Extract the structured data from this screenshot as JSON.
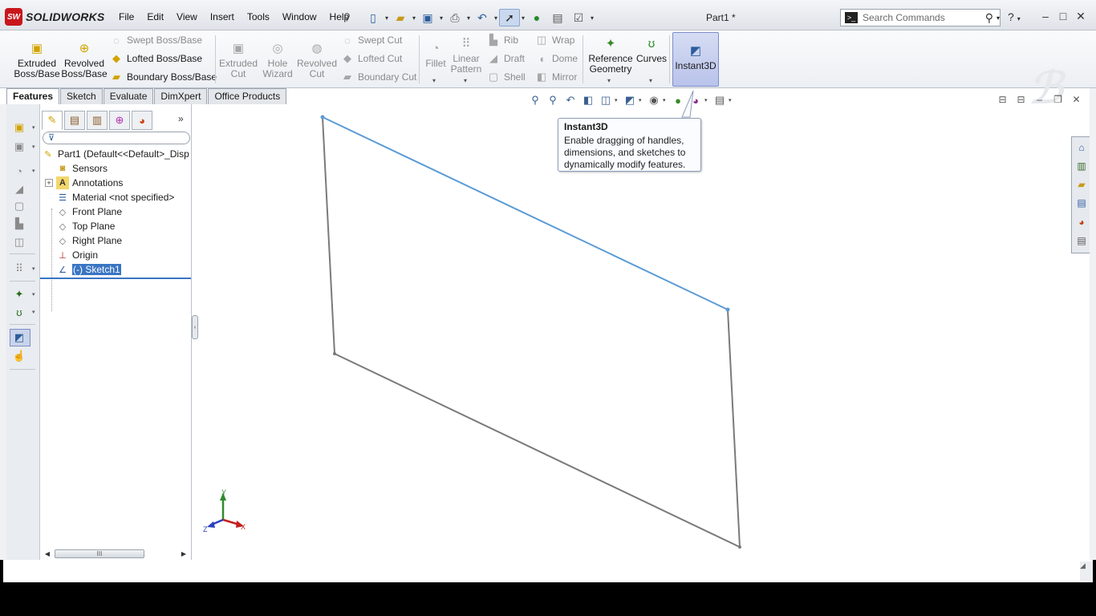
{
  "app": {
    "logo_prefix": "SW",
    "logo_name": "SOLIDWORKS",
    "document_title": "Part1 *"
  },
  "menu": [
    "File",
    "Edit",
    "View",
    "Insert",
    "Tools",
    "Window",
    "Help"
  ],
  "search": {
    "placeholder": "Search Commands"
  },
  "ribbon": {
    "extruded_boss": "Extruded\nBoss/Base",
    "revolved_boss": "Revolved\nBoss/Base",
    "swept_boss": "Swept Boss/Base",
    "lofted_boss": "Lofted Boss/Base",
    "boundary_boss": "Boundary Boss/Base",
    "extruded_cut": "Extruded\nCut",
    "hole_wizard": "Hole\nWizard",
    "revolved_cut": "Revolved\nCut",
    "swept_cut": "Swept Cut",
    "lofted_cut": "Lofted Cut",
    "boundary_cut": "Boundary Cut",
    "fillet": "Fillet",
    "linear_pattern": "Linear\nPattern",
    "rib": "Rib",
    "draft": "Draft",
    "shell": "Shell",
    "wrap": "Wrap",
    "dome": "Dome",
    "mirror": "Mirror",
    "reference_geometry": "Reference\nGeometry",
    "curves": "Curves",
    "instant3d": "Instant3D"
  },
  "tabs": [
    "Features",
    "Sketch",
    "Evaluate",
    "DimXpert",
    "Office Products"
  ],
  "tree": {
    "root": "Part1  (Default<<Default>_Disp",
    "items": [
      {
        "label": "Sensors"
      },
      {
        "label": "Annotations"
      },
      {
        "label": "Material <not specified>"
      },
      {
        "label": "Front Plane"
      },
      {
        "label": "Top Plane"
      },
      {
        "label": "Right Plane"
      },
      {
        "label": "Origin"
      },
      {
        "label": "(-) Sketch1"
      }
    ],
    "expand_marker": "+",
    "scroll_grip": "III"
  },
  "tooltip": {
    "title": "Instant3D",
    "description": "Enable dragging of handles, dimensions, and sketches to dynamically modify features."
  },
  "triad": {
    "x": "X",
    "y": "Y",
    "z": "Z"
  },
  "sketch": {
    "shape": "parallelogram",
    "highlighted_edge": "top",
    "highlight_color": "#5b9bd5",
    "edge_color": "#7a7a7a"
  },
  "icons": {
    "search": "magnifier-icon",
    "help": "help-icon"
  }
}
